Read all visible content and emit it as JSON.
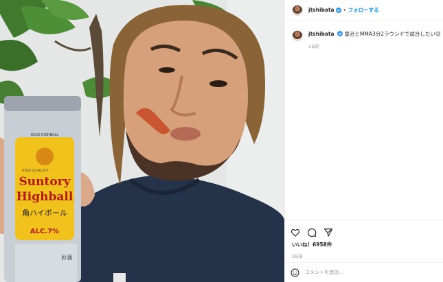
{
  "post": {
    "username": "jtshibata",
    "follow_label": "フォローする",
    "separator": "•",
    "caption_text": "皇治とMMA3分2ラウンドで試合したい😊",
    "caption_date": "2日前",
    "likes_label": "いいね！6958件",
    "post_date": "2日前",
    "comment_placeholder": "コメントを追加..."
  },
  "can": {
    "brand_small": "KAKU HIGHBALL",
    "brand_line1": "Suntory",
    "brand_line2": "Highball",
    "quality": "FINE QUALITY",
    "kanji": "角ハイボール",
    "abv": "ALC.7%",
    "side_text": "お酒"
  },
  "colors": {
    "accent": "#0095f6",
    "verified": "#3897f0",
    "muted": "#8e8e8e"
  },
  "icons": [
    "heart-icon",
    "comment-icon",
    "share-icon",
    "emoji-icon",
    "verified-icon"
  ]
}
